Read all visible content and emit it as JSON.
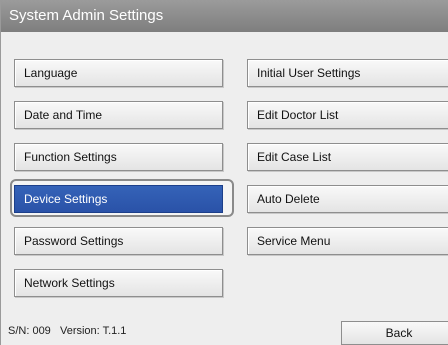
{
  "window": {
    "title": "System Admin Settings"
  },
  "menu": {
    "left": [
      {
        "label": "Language"
      },
      {
        "label": "Date and Time"
      },
      {
        "label": "Function Settings"
      },
      {
        "label": "Device Settings",
        "selected": true
      },
      {
        "label": "Password Settings"
      },
      {
        "label": "Network Settings"
      }
    ],
    "right": [
      {
        "label": "Initial User Settings"
      },
      {
        "label": "Edit Doctor List"
      },
      {
        "label": "Edit Case List"
      },
      {
        "label": "Auto Delete"
      },
      {
        "label": "Service Menu"
      }
    ]
  },
  "footer": {
    "status": "S/N: 009   Version: T.1.1",
    "back_label": "Back"
  },
  "colors": {
    "title_bar": "#8a8a8a",
    "selected": "#2f5cb3",
    "background": "#eeeeee"
  }
}
